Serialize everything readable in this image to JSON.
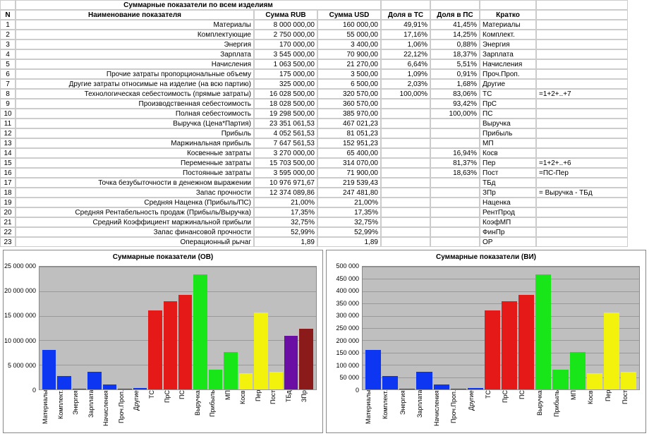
{
  "table": {
    "title": "Суммарные показатели по всем изделиям",
    "headers": [
      "N",
      "Наименование показателя",
      "Сумма RUB",
      "Сумма USD",
      "Доля в ТС",
      "Доля в ПС",
      "Кратко",
      ""
    ],
    "rows": [
      {
        "n": "1",
        "name": "Материалы",
        "rub": "8 000 000,00",
        "usd": "160 000,00",
        "tc": "49,91%",
        "pc": "41,45%",
        "short": "Материалы",
        "extra": ""
      },
      {
        "n": "2",
        "name": "Комплектующие",
        "rub": "2 750 000,00",
        "usd": "55 000,00",
        "tc": "17,16%",
        "pc": "14,25%",
        "short": "Комплект.",
        "extra": ""
      },
      {
        "n": "3",
        "name": "Энергия",
        "rub": "170 000,00",
        "usd": "3 400,00",
        "tc": "1,06%",
        "pc": "0,88%",
        "short": "Энергия",
        "extra": ""
      },
      {
        "n": "4",
        "name": "Зарплата",
        "rub": "3 545 000,00",
        "usd": "70 900,00",
        "tc": "22,12%",
        "pc": "18,37%",
        "short": "Зарплата",
        "extra": ""
      },
      {
        "n": "5",
        "name": "Начисления",
        "rub": "1 063 500,00",
        "usd": "21 270,00",
        "tc": "6,64%",
        "pc": "5,51%",
        "short": "Начисления",
        "extra": ""
      },
      {
        "n": "6",
        "name": "Прочие затраты пропорциональные объему",
        "rub": "175 000,00",
        "usd": "3 500,00",
        "tc": "1,09%",
        "pc": "0,91%",
        "short": "Проч.Проп.",
        "extra": ""
      },
      {
        "n": "7",
        "name": "Другие затраты относимые на изделие (на всю партию)",
        "rub": "325 000,00",
        "usd": "6 500,00",
        "tc": "2,03%",
        "pc": "1,68%",
        "short": "Другие",
        "extra": ""
      },
      {
        "n": "8",
        "name": "Технологическая себестоимость (прямые затраты)",
        "rub": "16 028 500,00",
        "usd": "320 570,00",
        "tc": "100,00%",
        "pc": "83,06%",
        "short": "ТС",
        "extra": "=1+2+..+7"
      },
      {
        "n": "9",
        "name": "Производственная себестоимость",
        "rub": "18 028 500,00",
        "usd": "360 570,00",
        "tc": "",
        "pc": "93,42%",
        "short": "ПрС",
        "extra": ""
      },
      {
        "n": "10",
        "name": "Полная себестоимость",
        "rub": "19 298 500,00",
        "usd": "385 970,00",
        "tc": "",
        "pc": "100,00%",
        "short": "ПС",
        "extra": ""
      },
      {
        "n": "11",
        "name": "Выручка (Цена*Партия)",
        "rub": "23 351 061,53",
        "usd": "467 021,23",
        "tc": "",
        "pc": "",
        "short": "Выручка",
        "extra": ""
      },
      {
        "n": "12",
        "name": "Прибыль",
        "rub": "4 052 561,53",
        "usd": "81 051,23",
        "tc": "",
        "pc": "",
        "short": "Прибыль",
        "extra": ""
      },
      {
        "n": "13",
        "name": "Маржинальная прибыль",
        "rub": "7 647 561,53",
        "usd": "152 951,23",
        "tc": "",
        "pc": "",
        "short": "МП",
        "extra": ""
      },
      {
        "n": "14",
        "name": "Косвенные затраты",
        "rub": "3 270 000,00",
        "usd": "65 400,00",
        "tc": "",
        "pc": "16,94%",
        "short": "Косв",
        "extra": ""
      },
      {
        "n": "15",
        "name": "Переменные затраты",
        "rub": "15 703 500,00",
        "usd": "314 070,00",
        "tc": "",
        "pc": "81,37%",
        "short": "Пер",
        "extra": "=1+2+..+6"
      },
      {
        "n": "16",
        "name": "Постоянные затраты",
        "rub": "3 595 000,00",
        "usd": "71 900,00",
        "tc": "",
        "pc": "18,63%",
        "short": "Пост",
        "extra": "=ПС-Пер"
      },
      {
        "n": "17",
        "name": "Точка безубыточности в денежном выражении",
        "rub": "10 976 971,67",
        "usd": "219 539,43",
        "tc": "",
        "pc": "",
        "short": "ТБд",
        "extra": ""
      },
      {
        "n": "18",
        "name": "Запас прочности",
        "rub": "12 374 089,86",
        "usd": "247 481,80",
        "tc": "",
        "pc": "",
        "short": "ЗПр",
        "extra": "= Выручка - ТБд"
      },
      {
        "n": "19",
        "name": "Средняя Наценка (Прибыль/ПС)",
        "rub": "21,00%",
        "usd": "21,00%",
        "tc": "",
        "pc": "",
        "short": "Наценка",
        "extra": ""
      },
      {
        "n": "20",
        "name": "Средняя Рентабельность продаж (Прибыль/Выручка)",
        "rub": "17,35%",
        "usd": "17,35%",
        "tc": "",
        "pc": "",
        "short": "РентПрод",
        "extra": ""
      },
      {
        "n": "21",
        "name": "Средний Коэффициент маржинальной прибыли",
        "rub": "32,75%",
        "usd": "32,75%",
        "tc": "",
        "pc": "",
        "short": "КоэфМП",
        "extra": ""
      },
      {
        "n": "22",
        "name": "Запас финансовой прочности",
        "rub": "52,99%",
        "usd": "52,99%",
        "tc": "",
        "pc": "",
        "short": "ФинПр",
        "extra": ""
      },
      {
        "n": "23",
        "name": "Операционный рычаг",
        "rub": "1,89",
        "usd": "1,89",
        "tc": "",
        "pc": "",
        "short": "ОР",
        "extra": ""
      }
    ]
  },
  "chart_data": [
    {
      "type": "bar",
      "title": "Суммарные показатели (ОВ)",
      "ylim": [
        0,
        25000000
      ],
      "ystep": 5000000,
      "yticks": [
        "0",
        "5 000 000",
        "10 000 000",
        "15 000 000",
        "20 000 000",
        "25 000 000"
      ],
      "categories": [
        "Материалы",
        "Комплект.",
        "Энергия",
        "Зарплата",
        "Начисления",
        "Проч.Проп.",
        "Другие",
        "ТС",
        "ПрС",
        "ПС",
        "Выручка",
        "Прибыль",
        "МП",
        "Косв",
        "Пер",
        "Пост",
        "ТБд",
        "ЗПр"
      ],
      "values": [
        8000000,
        2750000,
        170000,
        3545000,
        1063500,
        175000,
        325000,
        16028500,
        18028500,
        19298500,
        23351061,
        4052561,
        7647561,
        3270000,
        15703500,
        3595000,
        10976971,
        12374089
      ],
      "colors": [
        "c-blue",
        "c-blue",
        "c-blue",
        "c-blue",
        "c-blue",
        "c-blue",
        "c-blue",
        "c-red",
        "c-red",
        "c-red",
        "c-green",
        "c-green",
        "c-green",
        "c-yellow",
        "c-yellow",
        "c-yellow",
        "c-purple",
        "c-darkred"
      ]
    },
    {
      "type": "bar",
      "title": "Суммарные показатели (ВИ)",
      "ylim": [
        0,
        500000
      ],
      "ystep": 50000,
      "yticks": [
        "0",
        "50 000",
        "100 000",
        "150 000",
        "200 000",
        "250 000",
        "300 000",
        "350 000",
        "400 000",
        "450 000",
        "500 000"
      ],
      "categories": [
        "Материалы",
        "Комплект.",
        "Энергия",
        "Зарплата",
        "Начисления",
        "Проч.Проп.",
        "Другие",
        "ТС",
        "ПрС",
        "ПС",
        "Выручка",
        "Прибыль",
        "МП",
        "Косв",
        "Пер",
        "Пост"
      ],
      "values": [
        160000,
        55000,
        3400,
        70900,
        21270,
        3500,
        6500,
        320570,
        360570,
        385970,
        467021,
        81051,
        152951,
        65400,
        314070,
        71900
      ],
      "colors": [
        "c-blue",
        "c-blue",
        "c-blue",
        "c-blue",
        "c-blue",
        "c-blue",
        "c-blue",
        "c-red",
        "c-red",
        "c-red",
        "c-green",
        "c-green",
        "c-green",
        "c-yellow",
        "c-yellow",
        "c-yellow"
      ]
    }
  ]
}
